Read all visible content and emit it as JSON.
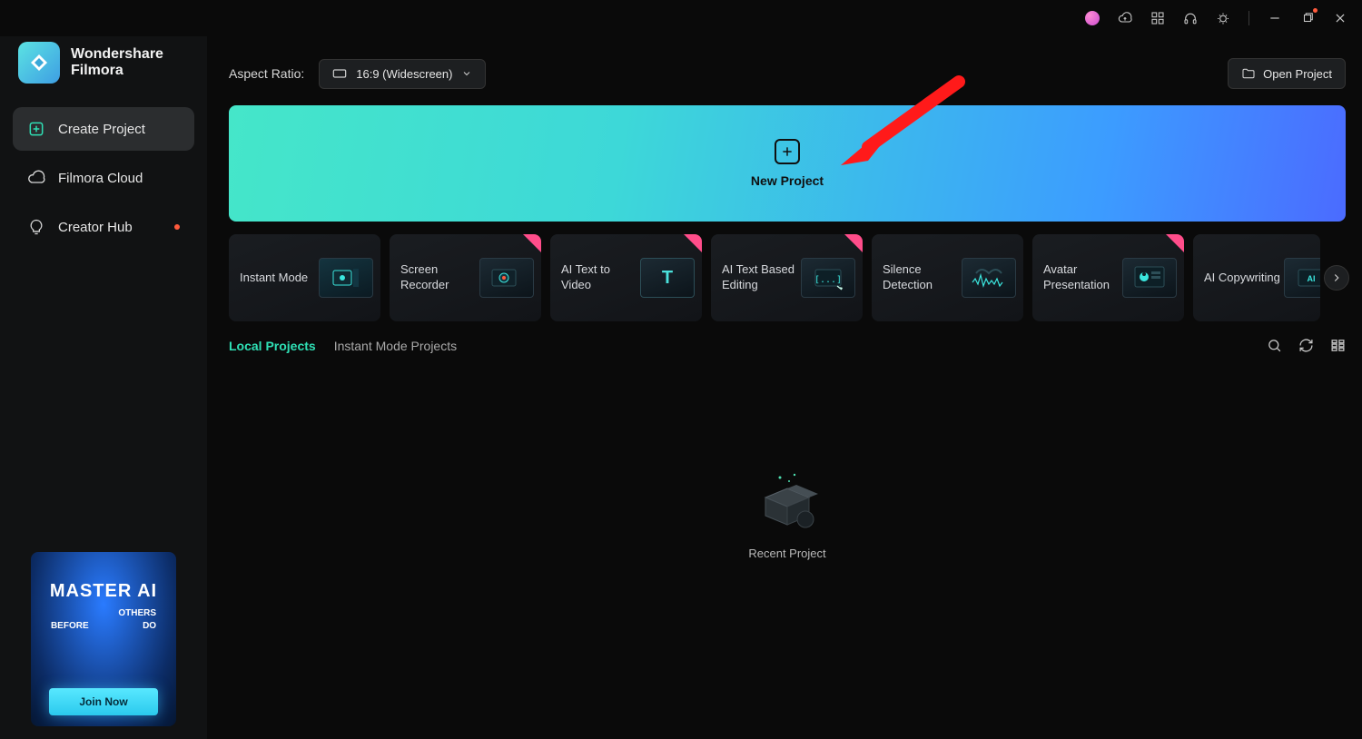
{
  "brand": {
    "line1": "Wondershare",
    "line2": "Filmora"
  },
  "sidebar": {
    "items": [
      {
        "label": "Create Project"
      },
      {
        "label": "Filmora Cloud"
      },
      {
        "label": "Creator Hub"
      }
    ]
  },
  "promo": {
    "title": "MASTER AI",
    "sub_left": "BEFORE",
    "sub_right1": "OTHERS",
    "sub_right2": "DO",
    "cta": "Join Now"
  },
  "toprow": {
    "aspect_label": "Aspect Ratio:",
    "aspect_value": "16:9 (Widescreen)",
    "open_project": "Open Project"
  },
  "new_project": {
    "label": "New Project"
  },
  "features": [
    {
      "label": "Instant Mode",
      "has_new": false
    },
    {
      "label": "Screen Recorder",
      "has_new": true
    },
    {
      "label": "AI Text to Video",
      "has_new": true
    },
    {
      "label": "AI Text Based Editing",
      "has_new": true
    },
    {
      "label": "Silence Detection",
      "has_new": false
    },
    {
      "label": "Avatar Presentation",
      "has_new": true
    },
    {
      "label": "AI Copywriting",
      "has_new": false
    }
  ],
  "tabs": {
    "local": "Local Projects",
    "instant": "Instant Mode Projects"
  },
  "empty": {
    "label": "Recent Project"
  }
}
